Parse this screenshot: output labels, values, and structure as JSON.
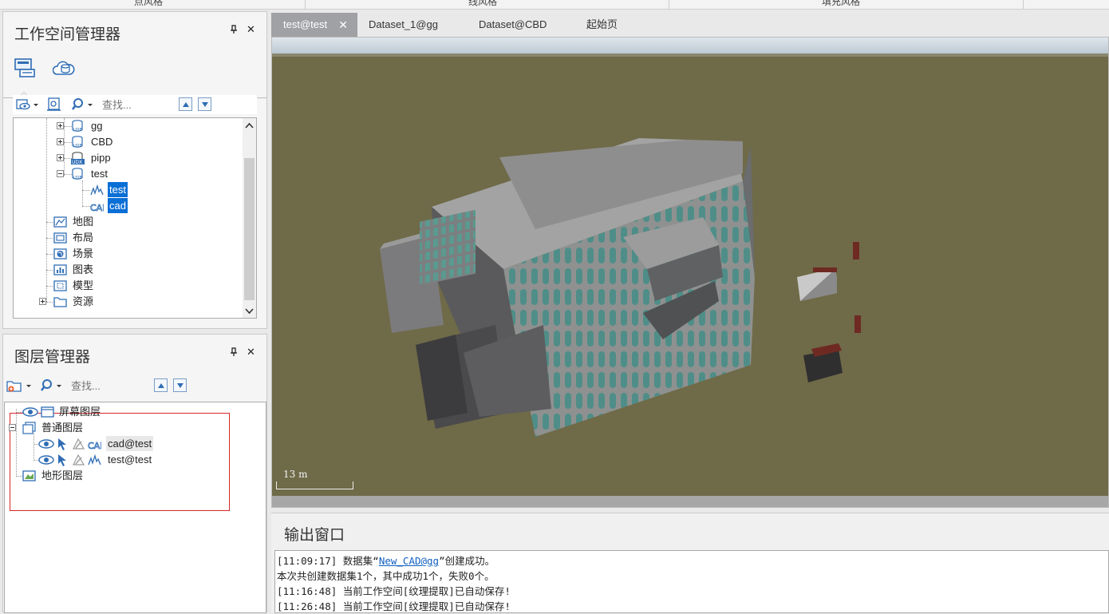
{
  "top_strip": {
    "labels": [
      "点风格",
      "线风格",
      "填充风格"
    ]
  },
  "workspace_manager": {
    "title": "工作空间管理器",
    "pin": "⊥",
    "close": "✕",
    "search_placeholder": "查找...",
    "tree": [
      {
        "label": "gg",
        "icon": "database-icon",
        "expanded": false
      },
      {
        "label": "CBD",
        "icon": "database-icon",
        "expanded": false
      },
      {
        "label": "pipp",
        "icon": "udx-database-icon",
        "expanded": false
      },
      {
        "label": "test",
        "icon": "database-icon",
        "expanded": true,
        "children": [
          {
            "label": "test",
            "icon": "line-dataset-icon",
            "selected": true
          },
          {
            "label": "cad",
            "icon": "cad-dataset-icon",
            "selected": true
          }
        ]
      },
      {
        "label": "地图",
        "icon": "map-icon"
      },
      {
        "label": "布局",
        "icon": "layout-icon"
      },
      {
        "label": "场景",
        "icon": "scene-icon"
      },
      {
        "label": "图表",
        "icon": "chart-icon"
      },
      {
        "label": "模型",
        "icon": "model-icon"
      },
      {
        "label": "资源",
        "icon": "folder-icon",
        "expanded": false
      }
    ]
  },
  "layer_manager": {
    "title": "图层管理器",
    "pin": "⊥",
    "close": "✕",
    "search_placeholder": "查找...",
    "tree": [
      {
        "label": "屏幕图层",
        "icon": "screen-layer-icon"
      },
      {
        "label": "普通图层",
        "icon": "normal-layer-icon",
        "expanded": true,
        "children": [
          {
            "label": "cad@test",
            "icon": "cad-dataset-icon"
          },
          {
            "label": "test@test",
            "icon": "line-dataset-icon"
          }
        ]
      },
      {
        "label": "地形图层",
        "icon": "terrain-layer-icon"
      }
    ]
  },
  "doc_tabs": [
    {
      "label": "test@test",
      "active": true,
      "close": "✕"
    },
    {
      "label": "Dataset_1@gg",
      "active": false
    },
    {
      "label": "Dataset@CBD",
      "active": false
    },
    {
      "label": "起始页",
      "active": false
    }
  ],
  "scene": {
    "scale_label": "13 m",
    "ground_color": "#6f6a48"
  },
  "output_window": {
    "title": "输出窗口",
    "lines": [
      {
        "prefix": "[11:09:17] 数据集“",
        "link": "New_CAD@gg",
        "suffix": "”创建成功。"
      },
      {
        "prefix": "本次共创建数据集1个，其中成功1个，失败0个。"
      },
      {
        "prefix": "[11:16:48] 当前工作空间[纹理提取]已自动保存!"
      },
      {
        "prefix": "[11:26:48] 当前工作空间[纹理提取]已自动保存!"
      }
    ]
  },
  "colors": {
    "selection": "#0a6fd6",
    "accent_icon": "#2f6db5",
    "highlight_box": "#d62828"
  }
}
